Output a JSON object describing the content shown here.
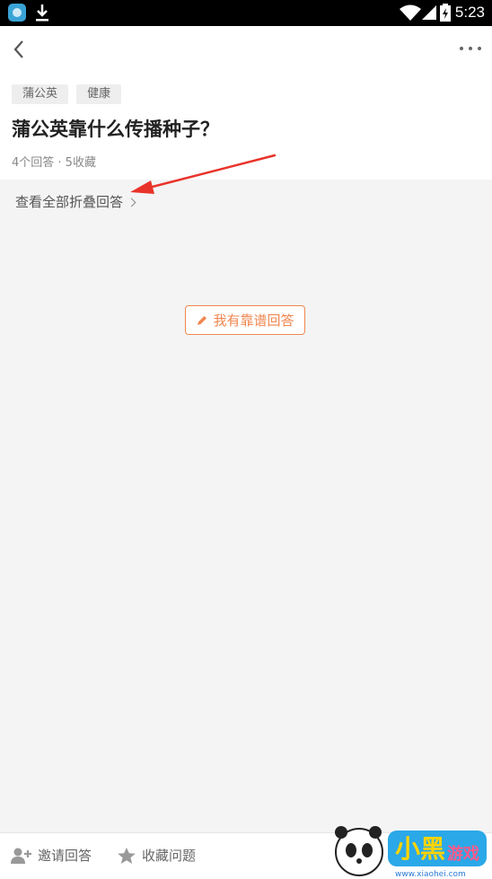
{
  "status_bar": {
    "time": "5:23"
  },
  "question": {
    "tags": [
      "蒲公英",
      "健康"
    ],
    "title": "蒲公英靠什么传播种子？",
    "meta": "4个回答 · 5收藏"
  },
  "folded_answers_label": "查看全部折叠回答",
  "answer_button_label": "我有靠谱回答",
  "bottom_bar": {
    "invite_label": "邀请回答",
    "favorite_label": "收藏问题"
  },
  "watermark": {
    "brand": "小黑游戏",
    "url": "www.xiaohei.com"
  },
  "colors": {
    "accent": "#f0874f",
    "annotation_arrow": "#e8332a"
  }
}
